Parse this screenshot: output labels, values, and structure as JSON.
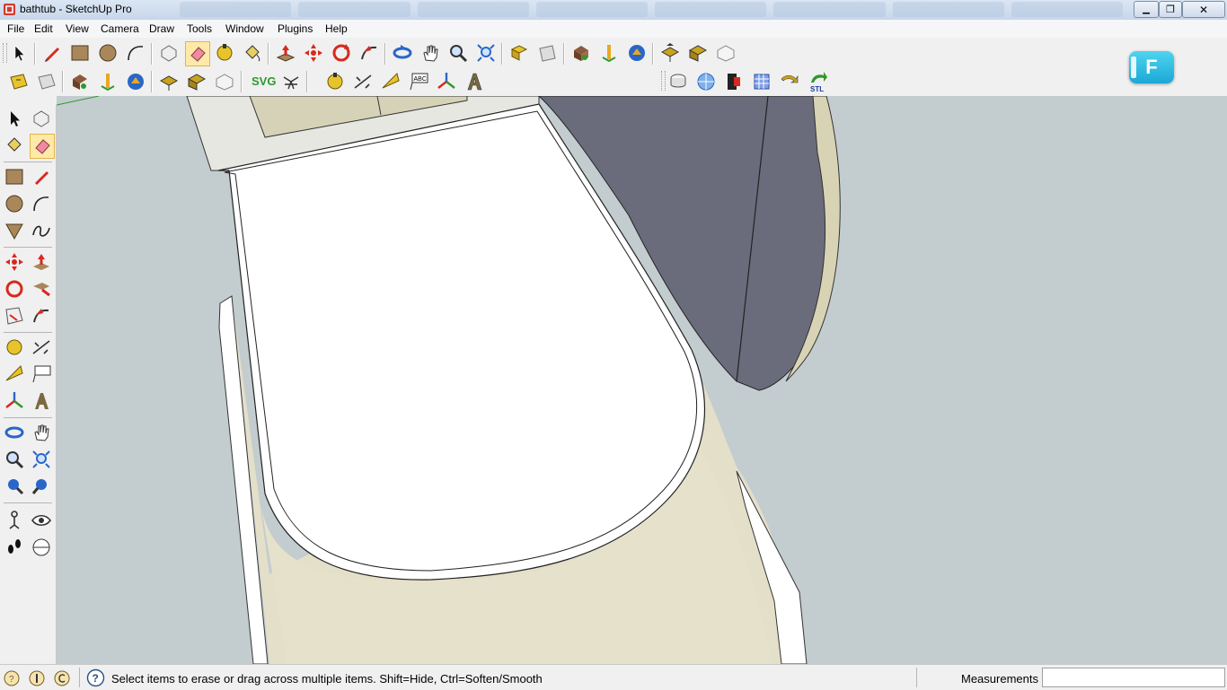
{
  "window": {
    "title": "bathtub - SketchUp Pro",
    "min_symbol": "▁",
    "max_symbol": "❐",
    "close_symbol": "✕"
  },
  "menubar": {
    "items": [
      "File",
      "Edit",
      "View",
      "Camera",
      "Draw",
      "Tools",
      "Window",
      "Plugins",
      "Help"
    ]
  },
  "toolbar": {
    "svg_label": "SVG",
    "stl_label": "STL",
    "text_tool_label": "ABC"
  },
  "overlay": {
    "badge_letter": "F"
  },
  "statusbar": {
    "hint": "Select items to erase or drag across multiple items. Shift=Hide, Ctrl=Soften/Smooth",
    "measurements_label": "Measurements",
    "measurements_value": ""
  },
  "colors": {
    "viewport_bg": "#c3cccf",
    "face_front": "#ffffff",
    "face_beige": "#e4dfc9",
    "face_dark": "#6a6c7c",
    "tool_red": "#d8281e",
    "tool_blue": "#2a66c8",
    "tool_green": "#2d9a2d"
  }
}
